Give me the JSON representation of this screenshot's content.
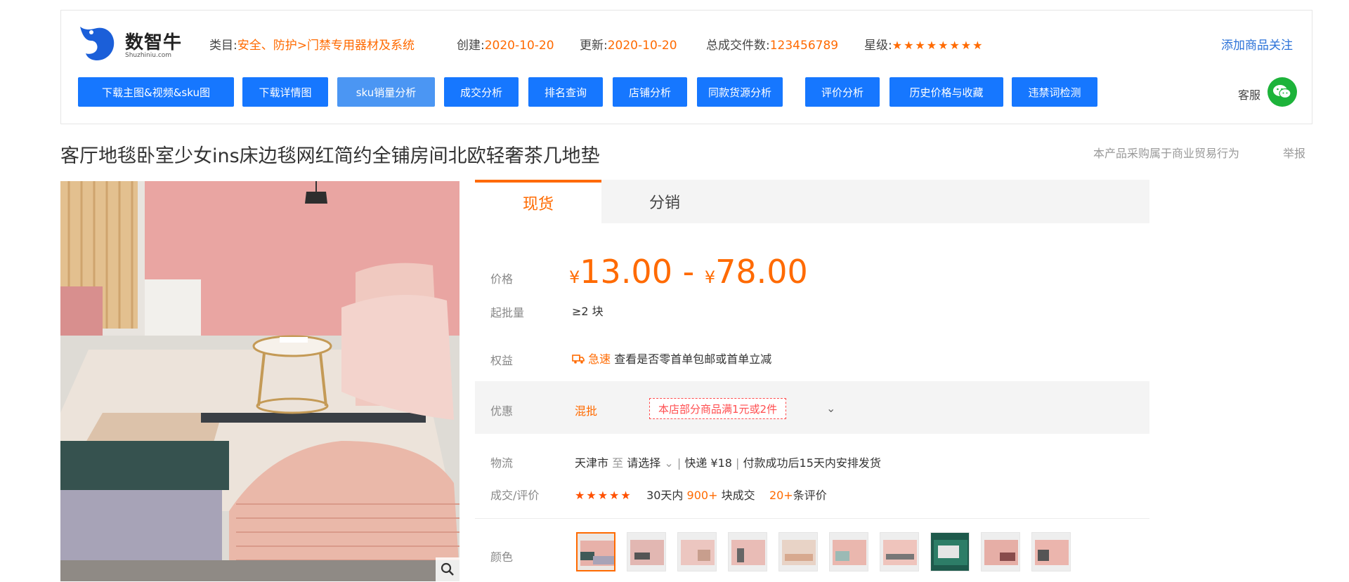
{
  "logo": {
    "brand_cn": "数智牛",
    "brand_en": "Shuzhiniu.com"
  },
  "meta": {
    "category_label": "类目:",
    "category_value": "安全、防护>门禁专用器材及系统",
    "created_label": "创建:",
    "created_value": "2020-10-20",
    "updated_label": "更新:",
    "updated_value": "2020-10-20",
    "total_label": "总成交件数:",
    "total_value": "123456789",
    "level_label": "星级:",
    "level_stars": "★★★★★★★★",
    "follow": "添加商品关注"
  },
  "toolbar": [
    {
      "label": "下载主图&视频&sku图"
    },
    {
      "label": "下载详情图"
    },
    {
      "label": "sku销量分析"
    },
    {
      "label": "成交分析"
    },
    {
      "label": "排名查询"
    },
    {
      "label": "店铺分析"
    },
    {
      "label": "同款货源分析"
    },
    {
      "label": "评价分析"
    },
    {
      "label": "历史价格与收藏"
    },
    {
      "label": "违禁词检测"
    }
  ],
  "service_label": "客服",
  "title": "客厅地毯卧室少女ins床边毯网红简约全铺房间北欧轻奢茶几地垫",
  "note": "本产品采购属于商业贸易行为",
  "report": "举报",
  "tabs": {
    "active": "现货",
    "other": "分销"
  },
  "labels": {
    "price": "价格",
    "moq": "起批量",
    "benefit": "权益",
    "promo": "优惠",
    "logistics": "物流",
    "rating": "成交/评价",
    "color": "颜色"
  },
  "price": {
    "currency": "¥",
    "low": "13.00",
    "sep": " - ",
    "high": "78.00"
  },
  "moq": "≥2 块",
  "benefit": {
    "tag": "急速",
    "text": "查看是否零首单包邮或首单立减"
  },
  "promo": {
    "tag": "混批",
    "coupon": "本店部分商品满1元或2件",
    "more": "⌄"
  },
  "logistics": {
    "from": "天津市",
    "to": "至",
    "dest": "请选择",
    "express": "快递 ¥18",
    "ship": "付款成功后15天内安排发货"
  },
  "rating": {
    "stars": "★★★★★",
    "period": "30天内",
    "count": "900+",
    "unit": "块成交",
    "reviews": "20+",
    "reviews_unit": "条评价"
  },
  "colors": {
    "wall": "#e9a5a2",
    "floor": "#dedbd5",
    "accent": "#ff6a00",
    "button": "#1677ff"
  }
}
